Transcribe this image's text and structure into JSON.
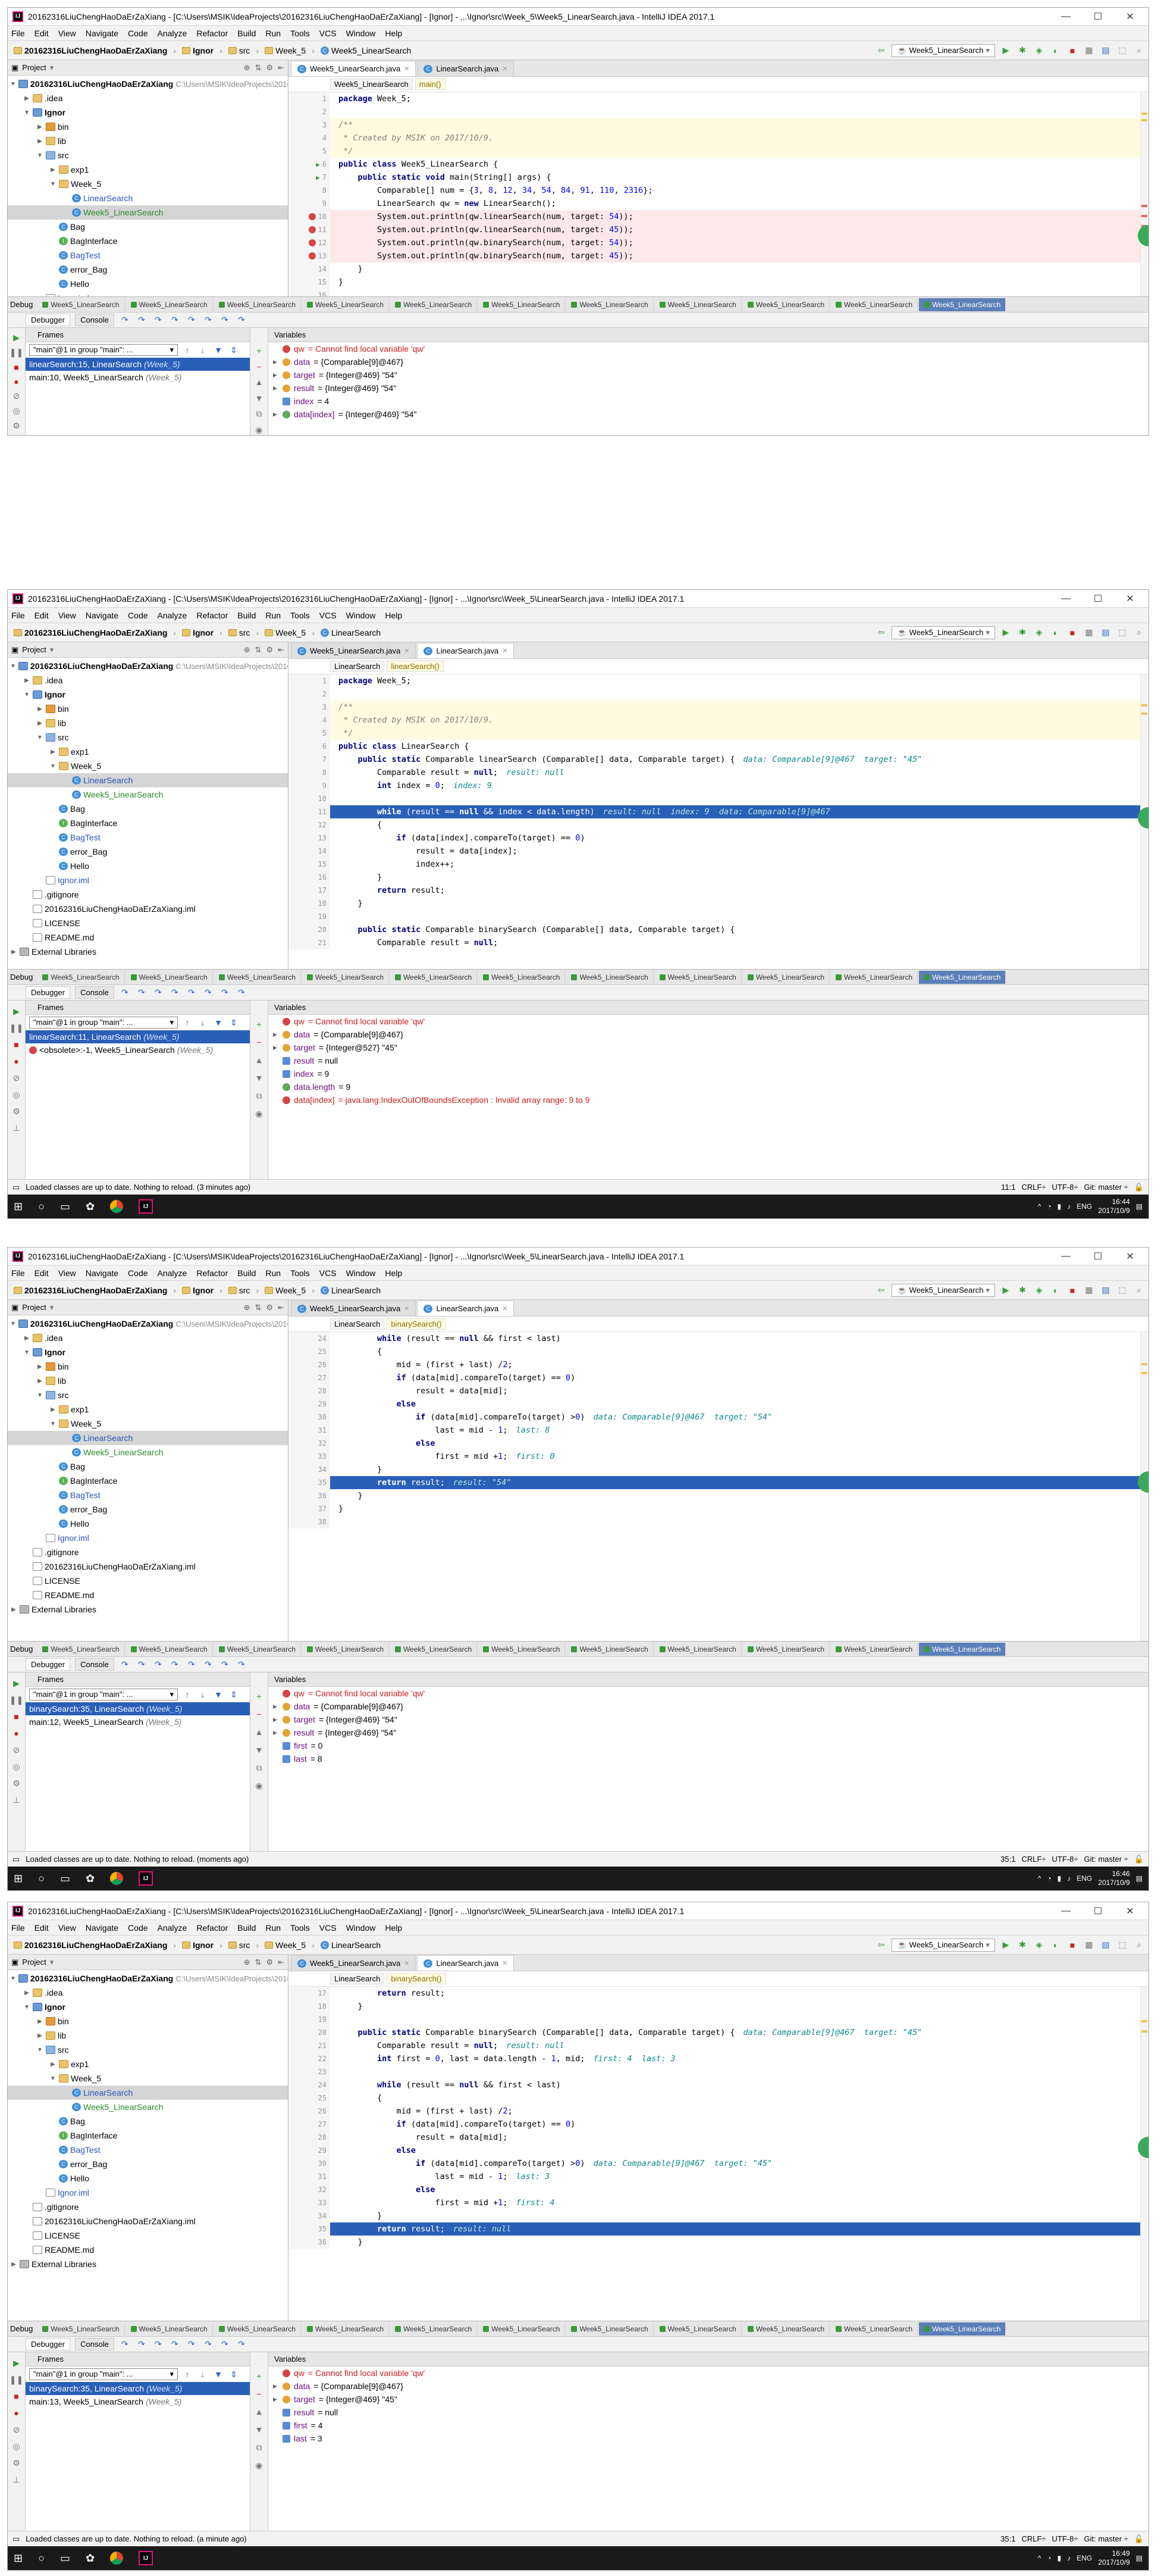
{
  "screens": [
    {
      "window_title": "20162316LiuChengHaoDaErZaXiang - [C:\\Users\\MSIK\\IdeaProjects\\20162316LiuChengHaoDaErZaXiang] - [Ignor] - ...\\Ignor\\src\\Week_5\\Week5_LinearSearch.java - IntelliJ IDEA 2017.1",
      "crumbs": [
        "20162316LiuChengHaoDaErZaXiang",
        "Ignor",
        "src",
        "Week_5",
        "Week5_LinearSearch"
      ],
      "run_config": "Week5_LinearSearch",
      "tabs": [
        "Week5_LinearSearch.java",
        "LinearSearch.java"
      ],
      "active_tab": 0,
      "code_breadcrumb": [
        "Week5_LinearSearch",
        "main()"
      ],
      "code_lines": [
        {
          "n": "1",
          "t": "package Week_5;",
          "k": "pkg"
        },
        {
          "n": "2",
          "t": ""
        },
        {
          "n": "3",
          "t": "/**",
          "k": "cm",
          "bg": "yel"
        },
        {
          "n": "4",
          "t": " * Created by MSIK on 2017/10/9.",
          "k": "cm",
          "bg": "yel"
        },
        {
          "n": "5",
          "t": " */",
          "k": "cm",
          "bg": "yel"
        },
        {
          "n": "6",
          "t": "public class Week5_LinearSearch {",
          "k": "decl",
          "run": true
        },
        {
          "n": "7",
          "t": "    public static void main(String[] args) {",
          "k": "decl",
          "run": true
        },
        {
          "n": "8",
          "t": "        Comparable[] num = {3, 8, 12, 34, 54, 84, 91, 110, 2316};"
        },
        {
          "n": "9",
          "t": "        LinearSearch qw = new LinearSearch();"
        },
        {
          "n": "10",
          "t": "        System.out.println(qw.linearSearch(num, target: 54));",
          "bg": "pink",
          "bp": true
        },
        {
          "n": "11",
          "t": "        System.out.println(qw.linearSearch(num, target: 45));",
          "bg": "pink",
          "bp": true
        },
        {
          "n": "12",
          "t": "        System.out.println(qw.binarySearch(num, target: 54));",
          "bg": "pink",
          "bp": true
        },
        {
          "n": "13",
          "t": "        System.out.println(qw.binarySearch(num, target: 45));",
          "bg": "pink",
          "bp": true
        },
        {
          "n": "14",
          "t": "    }"
        },
        {
          "n": "15",
          "t": "}"
        },
        {
          "n": "16",
          "t": ""
        }
      ],
      "debug_tabs": [
        "Week5_LinearSearch",
        "Week5_LinearSearch",
        "Week5_LinearSearch",
        "Week5_LinearSearch",
        "Week5_LinearSearch",
        "Week5_LinearSearch",
        "Week5_LinearSearch",
        "Week5_LinearSearch",
        "Week5_LinearSearch",
        "Week5_LinearSearch",
        "Week5_LinearSearch"
      ],
      "thread": "\"main\"@1 in group \"main\": ...",
      "frames": [
        {
          "name": "linearSearch:15, LinearSearch",
          "cls": "(Week_5)",
          "sel": true
        },
        {
          "name": "main:10, Week5_LinearSearch",
          "cls": "(Week_5)",
          "sel": false
        }
      ],
      "variables": [
        {
          "kind": "err",
          "name": "qw",
          "val": "= Cannot find local variable 'qw'",
          "err": true
        },
        {
          "kind": "obj",
          "name": "data",
          "val": "= {Comparable[9]@467}",
          "tog": true
        },
        {
          "kind": "obj",
          "name": "target",
          "val": "= {Integer@469} \"54\"",
          "tog": true
        },
        {
          "kind": "obj",
          "name": "result",
          "val": "= {Integer@469} \"54\"",
          "tog": true
        },
        {
          "kind": "prim",
          "name": "index",
          "val": "= 4"
        },
        {
          "kind": "wat",
          "name": "data[index]",
          "val": "= {Integer@469} \"54\"",
          "tog": true
        }
      ],
      "status": "",
      "clock_time": "",
      "clock_date": ""
    },
    {
      "window_title": "20162316LiuChengHaoDaErZaXiang - [C:\\Users\\MSIK\\IdeaProjects\\20162316LiuChengHaoDaErZaXiang] - [Ignor] - ...\\Ignor\\src\\Week_5\\LinearSearch.java - IntelliJ IDEA 2017.1",
      "crumbs": [
        "20162316LiuChengHaoDaErZaXiang",
        "Ignor",
        "src",
        "Week_5",
        "LinearSearch"
      ],
      "run_config": "Week5_LinearSearch",
      "tabs": [
        "Week5_LinearSearch.java",
        "LinearSearch.java"
      ],
      "active_tab": 1,
      "code_breadcrumb": [
        "LinearSearch",
        "linearSearch()"
      ],
      "code_lines": [
        {
          "n": "1",
          "t": "package Week_5;",
          "k": "pkg"
        },
        {
          "n": "2",
          "t": ""
        },
        {
          "n": "3",
          "t": "/**",
          "k": "cm",
          "bg": "yel"
        },
        {
          "n": "4",
          "t": " * Created by MSIK on 2017/10/9.",
          "k": "cm",
          "bg": "yel"
        },
        {
          "n": "5",
          "t": " */",
          "k": "cm",
          "bg": "yel"
        },
        {
          "n": "6",
          "t": "public class LinearSearch {",
          "k": "decl"
        },
        {
          "n": "7",
          "t": "    public static Comparable linearSearch (Comparable[] data, Comparable target) {",
          "k": "decl",
          "hint": "data: Comparable[9]@467  target: \"45\""
        },
        {
          "n": "8",
          "t": "        Comparable result = null;",
          "hint": "result: null"
        },
        {
          "n": "9",
          "t": "        int index = 0;",
          "hint": "index: 9"
        },
        {
          "n": "10",
          "t": ""
        },
        {
          "n": "11",
          "t": "        while (result == null && index < data.length)",
          "bg": "exec",
          "hint": "result: null  index: 9  data: Comparable[9]@467"
        },
        {
          "n": "12",
          "t": "        {"
        },
        {
          "n": "13",
          "t": "            if (data[index].compareTo(target) == 0)"
        },
        {
          "n": "14",
          "t": "                result = data[index];"
        },
        {
          "n": "15",
          "t": "                index++;"
        },
        {
          "n": "16",
          "t": "        }"
        },
        {
          "n": "17",
          "t": "        return result;"
        },
        {
          "n": "18",
          "t": "    }"
        },
        {
          "n": "19",
          "t": ""
        },
        {
          "n": "20",
          "t": "    public static Comparable binarySearch (Comparable[] data, Comparable target) {",
          "k": "decl"
        },
        {
          "n": "21",
          "t": "        Comparable result = null;"
        }
      ],
      "debug_tabs": [
        "Week5_LinearSearch",
        "Week5_LinearSearch",
        "Week5_LinearSearch",
        "Week5_LinearSearch",
        "Week5_LinearSearch",
        "Week5_LinearSearch",
        "Week5_LinearSearch",
        "Week5_LinearSearch",
        "Week5_LinearSearch",
        "Week5_LinearSearch",
        "Week5_LinearSearch"
      ],
      "thread": "\"main\"@1 in group \"main\": ...",
      "frames": [
        {
          "name": "linearSearch:11, LinearSearch",
          "cls": "(Week_5)",
          "sel": true
        },
        {
          "name": "<obsolete>:-1, Week5_LinearSearch",
          "cls": "(Week_5)",
          "sel": false,
          "err": true
        }
      ],
      "variables": [
        {
          "kind": "err",
          "name": "qw",
          "val": "= Cannot find local variable 'qw'",
          "err": true
        },
        {
          "kind": "obj",
          "name": "data",
          "val": "= {Comparable[9]@467}",
          "tog": true
        },
        {
          "kind": "obj",
          "name": "target",
          "val": "= {Integer@527} \"45\"",
          "tog": true
        },
        {
          "kind": "prim",
          "name": "result",
          "val": "= null"
        },
        {
          "kind": "prim",
          "name": "index",
          "val": "= 9"
        },
        {
          "kind": "wat",
          "name": "data.length",
          "val": "= 9"
        },
        {
          "kind": "err",
          "name": "data[index]",
          "val": "= java.lang.IndexOutOfBoundsException : Invalid array range: 9 to 9",
          "err": true
        }
      ],
      "status": "Loaded classes are up to date. Nothing to reload. (3 minutes ago)",
      "status_right": [
        "11:1",
        "CRLF÷",
        "UTF-8÷",
        "Git: master ÷"
      ],
      "clock_time": "16:44",
      "clock_date": "2017/10/9"
    },
    {
      "window_title": "20162316LiuChengHaoDaErZaXiang - [C:\\Users\\MSIK\\IdeaProjects\\20162316LiuChengHaoDaErZaXiang] - [Ignor] - ...\\Ignor\\src\\Week_5\\LinearSearch.java - IntelliJ IDEA 2017.1",
      "crumbs": [
        "20162316LiuChengHaoDaErZaXiang",
        "Ignor",
        "src",
        "Week_5",
        "LinearSearch"
      ],
      "run_config": "Week5_LinearSearch",
      "tabs": [
        "Week5_LinearSearch.java",
        "LinearSearch.java"
      ],
      "active_tab": 1,
      "code_breadcrumb": [
        "LinearSearch",
        "binarySearch()"
      ],
      "code_lines": [
        {
          "n": "24",
          "t": "        while (result == null && first < last)"
        },
        {
          "n": "25",
          "t": "        {"
        },
        {
          "n": "26",
          "t": "            mid = (first + last) /2;"
        },
        {
          "n": "27",
          "t": "            if (data[mid].compareTo(target) == 0)"
        },
        {
          "n": "28",
          "t": "                result = data[mid];"
        },
        {
          "n": "29",
          "t": "            else"
        },
        {
          "n": "30",
          "t": "                if (data[mid].compareTo(target) >0)",
          "hint": "data: Comparable[9]@467  target: \"54\""
        },
        {
          "n": "31",
          "t": "                    last = mid - 1;",
          "hint": "last: 8"
        },
        {
          "n": "32",
          "t": "                else"
        },
        {
          "n": "33",
          "t": "                    first = mid +1;",
          "hint": "first: 0"
        },
        {
          "n": "34",
          "t": "        }"
        },
        {
          "n": "35",
          "t": "        return result;",
          "bg": "exec",
          "hint": "result: \"54\""
        },
        {
          "n": "36",
          "t": "    }"
        },
        {
          "n": "37",
          "t": "}"
        },
        {
          "n": "38",
          "t": ""
        }
      ],
      "debug_tabs": [
        "Week5_LinearSearch",
        "Week5_LinearSearch",
        "Week5_LinearSearch",
        "Week5_LinearSearch",
        "Week5_LinearSearch",
        "Week5_LinearSearch",
        "Week5_LinearSearch",
        "Week5_LinearSearch",
        "Week5_LinearSearch",
        "Week5_LinearSearch",
        "Week5_LinearSearch"
      ],
      "thread": "\"main\"@1 in group \"main\": ...",
      "frames": [
        {
          "name": "binarySearch:35, LinearSearch",
          "cls": "(Week_5)",
          "sel": true
        },
        {
          "name": "main:12, Week5_LinearSearch",
          "cls": "(Week_5)",
          "sel": false
        }
      ],
      "variables": [
        {
          "kind": "err",
          "name": "qw",
          "val": "= Cannot find local variable 'qw'",
          "err": true
        },
        {
          "kind": "obj",
          "name": "data",
          "val": "= {Comparable[9]@467}",
          "tog": true
        },
        {
          "kind": "obj",
          "name": "target",
          "val": "= {Integer@469} \"54\"",
          "tog": true
        },
        {
          "kind": "obj",
          "name": "result",
          "val": "= {Integer@469} \"54\"",
          "tog": true
        },
        {
          "kind": "prim",
          "name": "first",
          "val": "= 0"
        },
        {
          "kind": "prim",
          "name": "last",
          "val": "= 8"
        }
      ],
      "status": "Loaded classes are up to date. Nothing to reload. (moments ago)",
      "status_right": [
        "35:1",
        "CRLF÷",
        "UTF-8÷",
        "Git: master ÷"
      ],
      "clock_time": "16:46",
      "clock_date": "2017/10/9"
    },
    {
      "window_title": "20162316LiuChengHaoDaErZaXiang - [C:\\Users\\MSIK\\IdeaProjects\\20162316LiuChengHaoDaErZaXiang] - [Ignor] - ...\\Ignor\\src\\Week_5\\LinearSearch.java - IntelliJ IDEA 2017.1",
      "crumbs": [
        "20162316LiuChengHaoDaErZaXiang",
        "Ignor",
        "src",
        "Week_5",
        "LinearSearch"
      ],
      "run_config": "Week5_LinearSearch",
      "tabs": [
        "Week5_LinearSearch.java",
        "LinearSearch.java"
      ],
      "active_tab": 1,
      "code_breadcrumb": [
        "LinearSearch",
        "binarySearch()"
      ],
      "code_lines": [
        {
          "n": "17",
          "t": "        return result;"
        },
        {
          "n": "18",
          "t": "    }"
        },
        {
          "n": "19",
          "t": ""
        },
        {
          "n": "20",
          "t": "    public static Comparable binarySearch (Comparable[] data, Comparable target) {",
          "k": "decl",
          "hint": "data: Comparable[9]@467  target: \"45\""
        },
        {
          "n": "21",
          "t": "        Comparable result = null;",
          "hint": "result: null"
        },
        {
          "n": "22",
          "t": "        int first = 0, last = data.length - 1, mid;",
          "hint": "first: 4  last: 3"
        },
        {
          "n": "23",
          "t": ""
        },
        {
          "n": "24",
          "t": "        while (result == null && first < last)"
        },
        {
          "n": "25",
          "t": "        {"
        },
        {
          "n": "26",
          "t": "            mid = (first + last) /2;"
        },
        {
          "n": "27",
          "t": "            if (data[mid].compareTo(target) == 0)"
        },
        {
          "n": "28",
          "t": "                result = data[mid];"
        },
        {
          "n": "29",
          "t": "            else"
        },
        {
          "n": "30",
          "t": "                if (data[mid].compareTo(target) >0)",
          "hint": "data: Comparable[9]@467  target: \"45\""
        },
        {
          "n": "31",
          "t": "                    last = mid - 1;",
          "hint": "last: 3"
        },
        {
          "n": "32",
          "t": "                else"
        },
        {
          "n": "33",
          "t": "                    first = mid +1;",
          "hint": "first: 4"
        },
        {
          "n": "34",
          "t": "        }"
        },
        {
          "n": "35",
          "t": "        return result;",
          "bg": "exec",
          "hint": "result: null"
        },
        {
          "n": "36",
          "t": "    }"
        }
      ],
      "debug_tabs": [
        "Week5_LinearSearch",
        "Week5_LinearSearch",
        "Week5_LinearSearch",
        "Week5_LinearSearch",
        "Week5_LinearSearch",
        "Week5_LinearSearch",
        "Week5_LinearSearch",
        "Week5_LinearSearch",
        "Week5_LinearSearch",
        "Week5_LinearSearch",
        "Week5_LinearSearch"
      ],
      "thread": "\"main\"@1 in group \"main\": ...",
      "frames": [
        {
          "name": "binarySearch:35, LinearSearch",
          "cls": "(Week_5)",
          "sel": true
        },
        {
          "name": "main:13, Week5_LinearSearch",
          "cls": "(Week_5)",
          "sel": false
        }
      ],
      "variables": [
        {
          "kind": "err",
          "name": "qw",
          "val": "= Cannot find local variable 'qw'",
          "err": true
        },
        {
          "kind": "obj",
          "name": "data",
          "val": "= {Comparable[9]@467}",
          "tog": true
        },
        {
          "kind": "obj",
          "name": "target",
          "val": "= {Integer@469} \"45\"",
          "tog": true
        },
        {
          "kind": "prim",
          "name": "result",
          "val": "= null"
        },
        {
          "kind": "prim",
          "name": "first",
          "val": "= 4"
        },
        {
          "kind": "prim",
          "name": "last",
          "val": "= 3"
        }
      ],
      "status": "Loaded classes are up to date. Nothing to reload. (a minute ago)",
      "status_right": [
        "35:1",
        "CRLF÷",
        "UTF-8÷",
        "Git: master ÷"
      ],
      "clock_time": "16:49",
      "clock_date": "2017/10/9"
    }
  ],
  "menu": [
    "File",
    "Edit",
    "View",
    "Navigate",
    "Code",
    "Analyze",
    "Refactor",
    "Build",
    "Run",
    "Tools",
    "VCS",
    "Window",
    "Help"
  ],
  "project_label": "Project",
  "tree": [
    {
      "d": 0,
      "ico": "module",
      "t": "20162316LiuChengHaoDaErZaXiang",
      "sub": "C:\\Users\\MSIK\\IdeaProjects\\20162316LiuChengHaoDaErZaXiang",
      "bold": true,
      "open": true
    },
    {
      "d": 1,
      "ico": "folder",
      "t": ".idea",
      "closed": true
    },
    {
      "d": 1,
      "ico": "module",
      "t": "Ignor",
      "bold": true,
      "open": true
    },
    {
      "d": 2,
      "ico": "ofolder",
      "t": "bin",
      "closed": true
    },
    {
      "d": 2,
      "ico": "folder",
      "t": "lib",
      "closed": true
    },
    {
      "d": 2,
      "ico": "pfolder",
      "t": "src",
      "open": true
    },
    {
      "d": 3,
      "ico": "folder",
      "t": "exp1",
      "closed": true
    },
    {
      "d": 3,
      "ico": "folder",
      "t": "Week_5",
      "open": true
    },
    {
      "d": 4,
      "ico": "cls",
      "t": "LinearSearch",
      "blue": true,
      "sel_on": [
        1,
        2,
        3
      ]
    },
    {
      "d": 4,
      "ico": "cls",
      "t": "Week5_LinearSearch",
      "green": true,
      "sel_on": [
        0
      ]
    },
    {
      "d": 3,
      "ico": "cls",
      "t": "Bag"
    },
    {
      "d": 3,
      "ico": "itf",
      "t": "BagInterface"
    },
    {
      "d": 3,
      "ico": "cls",
      "t": "BagTest",
      "blue": true
    },
    {
      "d": 3,
      "ico": "cls",
      "t": "error_Bag"
    },
    {
      "d": 3,
      "ico": "cls",
      "t": "Hello"
    },
    {
      "d": 2,
      "ico": "file",
      "t": "Ignor.iml",
      "blue": true
    },
    {
      "d": 1,
      "ico": "file",
      "t": ".gitignore"
    },
    {
      "d": 1,
      "ico": "file",
      "t": "20162316LiuChengHaoDaErZaXiang.iml"
    },
    {
      "d": 1,
      "ico": "file",
      "t": "LICENSE"
    },
    {
      "d": 1,
      "ico": "file",
      "t": "README.md"
    },
    {
      "d": 0,
      "ico": "lib",
      "t": "External Libraries",
      "closed": true
    }
  ],
  "labels": {
    "debug": "Debug",
    "debugger": "Debugger",
    "console": "Console",
    "frames": "Frames",
    "variables": "Variables",
    "lang": "ENG"
  },
  "colors": {
    "accent": "#2a5fb8",
    "error": "#cc1e1e",
    "ide_bg": "#f2f2f2"
  }
}
